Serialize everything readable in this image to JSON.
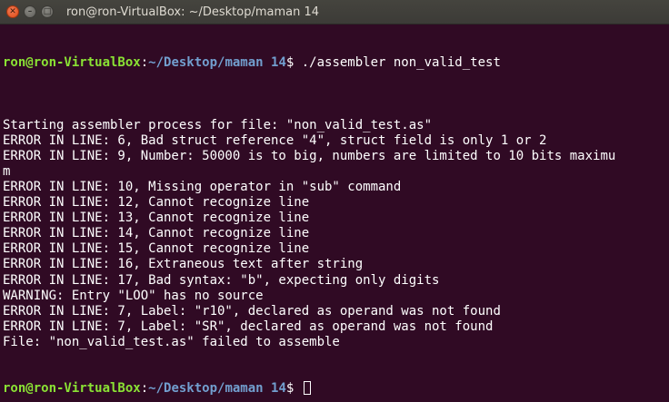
{
  "window": {
    "title": "ron@ron-VirtualBox: ~/Desktop/maman 14",
    "controls": {
      "close_glyph": "✕",
      "minimize_glyph": "–",
      "maximize_glyph": "□"
    }
  },
  "colors": {
    "background": "#300a24",
    "prompt_user": "#8ae234",
    "prompt_path": "#729fcf",
    "text": "#ffffff",
    "titlebar": "#3c3b37",
    "close_button": "#df4a16"
  },
  "prompt": {
    "user_host": "ron@ron-VirtualBox",
    "separator": ":",
    "path": "~/Desktop/maman 14",
    "symbol": "$ "
  },
  "command": "./assembler non_valid_test",
  "output": [
    "",
    "Starting assembler process for file: \"non_valid_test.as\"",
    "ERROR IN LINE: 6, Bad struct reference \"4\", struct field is only 1 or 2",
    "ERROR IN LINE: 9, Number: 50000 is to big, numbers are limited to 10 bits maximu",
    "m",
    "ERROR IN LINE: 10, Missing operator in \"sub\" command",
    "ERROR IN LINE: 12, Cannot recognize line",
    "ERROR IN LINE: 13, Cannot recognize line",
    "ERROR IN LINE: 14, Cannot recognize line",
    "ERROR IN LINE: 15, Cannot recognize line",
    "ERROR IN LINE: 16, Extraneous text after string",
    "ERROR IN LINE: 17, Bad syntax: \"b\", expecting only digits",
    "WARNING: Entry \"LOO\" has no source",
    "ERROR IN LINE: 7, Label: \"r10\", declared as operand was not found",
    "ERROR IN LINE: 7, Label: \"SR\", declared as operand was not found",
    "File: \"non_valid_test.as\" failed to assemble"
  ]
}
